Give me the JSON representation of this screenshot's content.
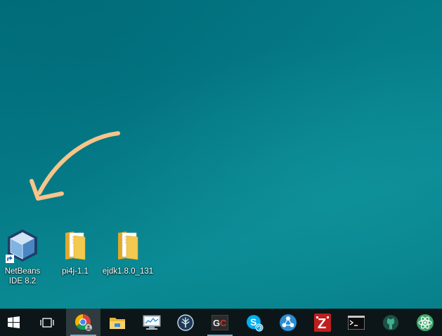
{
  "desktop": {
    "icons": [
      {
        "label": "NetBeans IDE 8.2",
        "icon": "netbeans-cube-icon",
        "shortcut": true
      },
      {
        "label": "pi4j-1.1",
        "icon": "folder-icon"
      },
      {
        "label": "ejdk1.8.0_131",
        "icon": "folder-icon"
      }
    ],
    "annotation": {
      "type": "hand-drawn-arrow",
      "color": "#f7c48a",
      "points_to": "NetBeans IDE 8.2"
    }
  },
  "taskbar": {
    "buttons": [
      {
        "name": "start-button",
        "icon": "windows-logo-icon"
      },
      {
        "name": "task-view-button",
        "icon": "task-view-icon"
      },
      {
        "name": "chrome-button",
        "icon": "chrome-icon",
        "state": "active"
      },
      {
        "name": "file-explorer-button",
        "icon": "folder-icon"
      },
      {
        "name": "resource-monitor-button",
        "icon": "monitor-icon"
      },
      {
        "name": "raspberry-app-button",
        "icon": "tree-badge-icon"
      },
      {
        "name": "gc-app-button",
        "icon": "gc-icon",
        "text": "GC",
        "state": "running"
      },
      {
        "name": "skype-button",
        "icon": "skype-icon"
      },
      {
        "name": "share-app-button",
        "icon": "share-nodes-icon"
      },
      {
        "name": "filezilla-button",
        "icon": "filezilla-icon",
        "text": "Z"
      },
      {
        "name": "command-prompt-button",
        "icon": "console-icon"
      },
      {
        "name": "github-button",
        "icon": "octocat-icon"
      },
      {
        "name": "atom-button",
        "icon": "atom-icon"
      }
    ]
  },
  "colors": {
    "desktop_background": "#067f8b",
    "taskbar": "#0c1618",
    "arrow": "#f7c48a",
    "folder": "#f3c94f"
  }
}
